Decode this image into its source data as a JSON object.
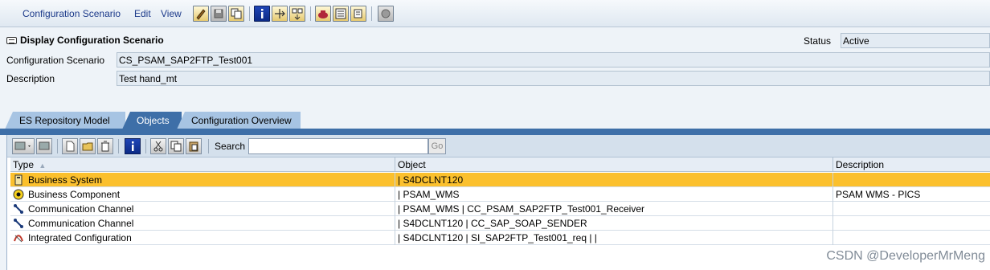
{
  "menu": {
    "items": [
      "Configuration Scenario",
      "Edit",
      "View"
    ]
  },
  "toolbar": {
    "icons": [
      "pencil-icon",
      "save-icon",
      "copy-icon",
      "info-icon",
      "move-icon",
      "compare-icon",
      "teapot-icon",
      "list-icon",
      "scroll-icon",
      "circle-icon"
    ]
  },
  "header": {
    "title": "Display Configuration Scenario",
    "status_label": "Status",
    "status_value": "Active",
    "scenario_label": "Configuration Scenario",
    "scenario_value": "CS_PSAM_SAP2FTP_Test001",
    "description_label": "Description",
    "description_value": "Test hand_mt"
  },
  "tabs": [
    {
      "label": "ES Repository Model",
      "active": false
    },
    {
      "label": "Objects",
      "active": true
    },
    {
      "label": "Configuration Overview",
      "active": false
    }
  ],
  "panel_toolbar": {
    "search_label": "Search",
    "search_value": "",
    "go_label": "Go"
  },
  "table": {
    "columns": [
      "Type",
      "Object",
      "Description"
    ],
    "sort_indicator": "▲",
    "rows": [
      {
        "type": "Business System",
        "object": "| S4DCLNT120",
        "description": "",
        "icon": "business-system-icon",
        "selected": true
      },
      {
        "type": "Business Component",
        "object": "| PSAM_WMS",
        "description": "PSAM WMS - PICS",
        "icon": "business-component-icon",
        "selected": false
      },
      {
        "type": "Communication Channel",
        "object": "| PSAM_WMS | CC_PSAM_SAP2FTP_Test001_Receiver",
        "description": "",
        "icon": "communication-channel-icon",
        "selected": false
      },
      {
        "type": "Communication Channel",
        "object": "| S4DCLNT120 | CC_SAP_SOAP_SENDER",
        "description": "",
        "icon": "communication-channel-icon",
        "selected": false
      },
      {
        "type": "Integrated Configuration",
        "object": "| S4DCLNT120 | SI_SAP2FTP_Test001_req | |",
        "description": "",
        "icon": "integrated-configuration-icon",
        "selected": false
      }
    ]
  },
  "watermark": "CSDN @DeveloperMrMeng",
  "colors": {
    "selected_row": "#fbc02d",
    "active_tab": "#3e6fa8",
    "inactive_tab": "#a7c4e3",
    "field_bg": "#e3ebf3"
  }
}
